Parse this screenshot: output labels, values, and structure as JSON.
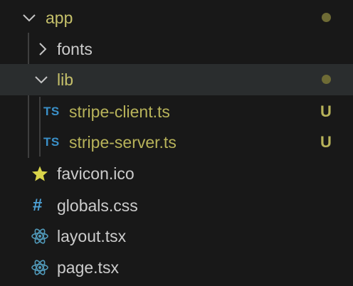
{
  "colors": {
    "background": "#181818",
    "selected_row": "#2a2d2e",
    "folder_text": "#c5c06a",
    "modified_text": "#b8b35a",
    "normal_text": "#cccccc",
    "chevron": "#c5c5c5",
    "ts_blue": "#3a90c9",
    "css_blue": "#4ea3d8",
    "react_blue": "#519aba",
    "star_yellow": "#d9d44a",
    "dot_color": "#6e6b35",
    "untracked": "#b8b35a"
  },
  "tree": {
    "app": {
      "label": "app",
      "status_dot": "modified-dot"
    },
    "fonts": {
      "label": "fonts"
    },
    "lib": {
      "label": "lib",
      "status_dot": "modified-dot"
    },
    "stripe_client": {
      "icon_text": "TS",
      "label": "stripe-client.ts",
      "status": "U"
    },
    "stripe_server": {
      "icon_text": "TS",
      "label": "stripe-server.ts",
      "status": "U"
    },
    "favicon": {
      "label": "favicon.ico",
      "icon": "star-icon"
    },
    "globals": {
      "icon_text": "#",
      "label": "globals.css"
    },
    "layout": {
      "label": "layout.tsx",
      "icon": "react-icon"
    },
    "page": {
      "label": "page.tsx",
      "icon": "react-icon"
    }
  }
}
